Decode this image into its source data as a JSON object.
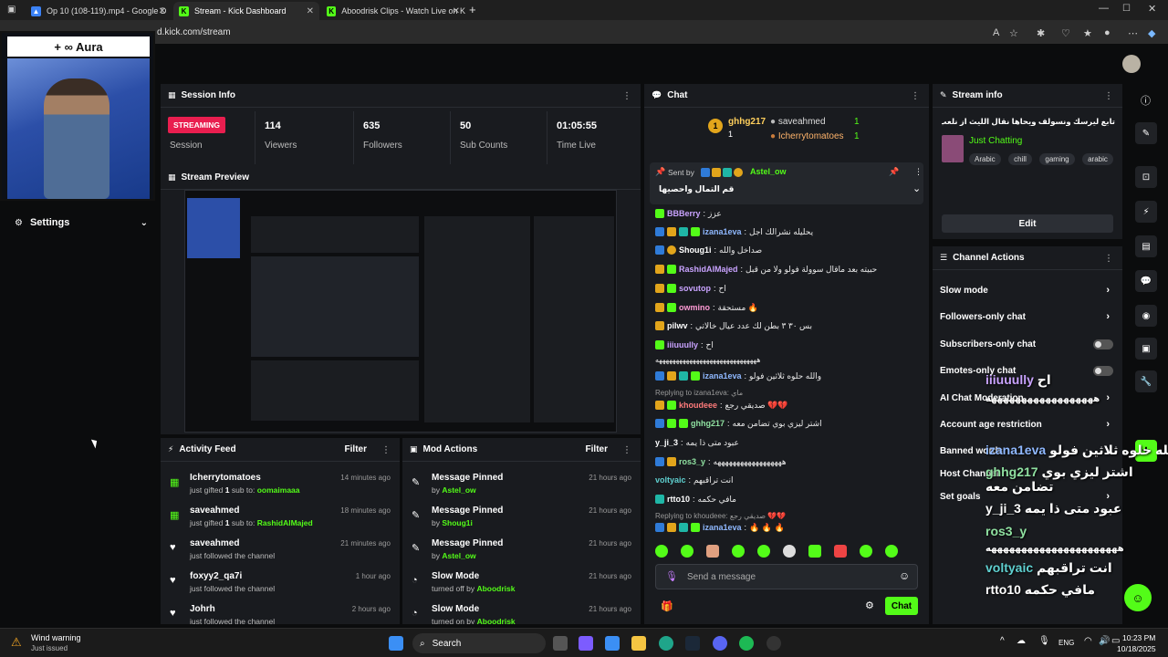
{
  "browser": {
    "tabs": [
      {
        "label": "Op 10 (108-119).mp4 - Google D"
      },
      {
        "label": "Stream - Kick Dashboard"
      },
      {
        "label": "Aboodrisk Clips - Watch Live on K"
      }
    ],
    "url": "d.kick.com/stream"
  },
  "webcam": {
    "label": "+ ∞ Aura"
  },
  "sidebar": {
    "settings_label": "Settings"
  },
  "session": {
    "title": "Session Info",
    "status": "STREAMING",
    "status_label": "Session",
    "stats": [
      {
        "value": "114",
        "label": "Viewers"
      },
      {
        "value": "635",
        "label": "Followers"
      },
      {
        "value": "50",
        "label": "Sub Counts"
      },
      {
        "value": "01:05:55",
        "label": "Time Live"
      }
    ]
  },
  "preview": {
    "title": "Stream Preview"
  },
  "activity": {
    "title": "Activity Feed",
    "filter": "Filter",
    "items": [
      {
        "name": "Icherrytomatoes",
        "pre": "just gifted ",
        "count": "1",
        "mid": " sub to: ",
        "target": "oomaimaaa",
        "time": "14 minutes ago"
      },
      {
        "name": "saveahmed",
        "pre": "just gifted ",
        "count": "1",
        "mid": " sub to: ",
        "target": "RashidAlMajed",
        "time": "18 minutes ago"
      },
      {
        "name": "saveahmed",
        "pre": "just followed the channel",
        "count": "",
        "mid": "",
        "target": "",
        "time": "21 minutes ago"
      },
      {
        "name": "foxyy2_qa7i",
        "pre": "just followed the channel",
        "count": "",
        "mid": "",
        "target": "",
        "time": "1 hour ago"
      },
      {
        "name": "Johrh",
        "pre": "just followed the channel",
        "count": "",
        "mid": "",
        "target": "",
        "time": "2 hours ago"
      }
    ]
  },
  "mod": {
    "title": "Mod Actions",
    "filter": "Filter",
    "items": [
      {
        "action": "Message Pinned",
        "by": "by ",
        "who": "Astel_ow",
        "time": "21 hours ago"
      },
      {
        "action": "Message Pinned",
        "by": "by ",
        "who": "Shoug1i",
        "time": "21 hours ago"
      },
      {
        "action": "Message Pinned",
        "by": "by ",
        "who": "Astel_ow",
        "time": "21 hours ago"
      },
      {
        "action": "Slow Mode",
        "by": "turned off by ",
        "who": "Aboodrisk",
        "time": "21 hours ago"
      },
      {
        "action": "Slow Mode",
        "by": "turned on by ",
        "who": "Aboodrisk",
        "time": "21 hours ago"
      }
    ]
  },
  "chat": {
    "title": "Chat",
    "top_gifters": [
      {
        "name": "ghhg217",
        "count": "1"
      },
      {
        "name": "saveahmed",
        "count": "1"
      },
      {
        "name": "Icherrytomatoes",
        "count": "1"
      }
    ],
    "pinned": {
      "sent_by": "Sent by",
      "user": "Astel_ow",
      "text": "قم التمال واحصيها"
    },
    "messages": [
      {
        "user": "BBBerry",
        "color": "#c9a3ff",
        "text": "عزز"
      },
      {
        "user": "izana1eva",
        "color": "#8fb8ff",
        "text": "يحليله نشرالك اجل"
      },
      {
        "user": "Shoug1i",
        "color": "#ffffff",
        "text": "صداخل والله"
      },
      {
        "user": "RashidAlMajed",
        "color": "#c9a3ff",
        "text": "حبيته بعد ماقال سوولة فولو ولا من قبل"
      },
      {
        "user": "sovutop",
        "color": "#c9a3ff",
        "text": "اح"
      },
      {
        "user": "owmino",
        "color": "#ff9ad5",
        "text": "مستحقة 🔥"
      },
      {
        "user": "pilwv",
        "color": "#ffffff",
        "text": "بس ٣٠ ٣ بطن لك عدد عيال خالاتي"
      },
      {
        "user": "iiiuuully",
        "color": "#c9a3ff",
        "text": "اح"
      },
      {
        "user": "",
        "color": "#ffffff",
        "text": "ههههههههههههههههههههههههههههههه"
      },
      {
        "user": "izana1eva",
        "color": "#8fb8ff",
        "text": "والله حلوه ثلاثين فولو"
      },
      {
        "user": "khoudeee",
        "color": "#ff7b7b",
        "text": "صديقي رجع 💔💔"
      },
      {
        "user": "ghhg217",
        "color": "#8fe0a0",
        "text": "اشتر ليزي بوي تضامن معه"
      },
      {
        "user": "y_ji_3",
        "color": "#ffffff",
        "text": "عبود متى ذا يمه"
      },
      {
        "user": "ros3_y",
        "color": "#8fe0a0",
        "text": "ههههههههههههههههههه"
      },
      {
        "user": "voltyaic",
        "color": "#5fd0d0",
        "text": "انت تراقبهم"
      },
      {
        "user": "rtto10",
        "color": "#ffffff",
        "text": "مافي حكمه"
      },
      {
        "user": "izana1eva",
        "color": "#8fb8ff",
        "text": "🔥 🔥 🔥"
      }
    ],
    "reply_1": "Replying to izana1eva: ماي",
    "reply_2": "Replying to khoudeee: صديقي رجع 💔💔",
    "input_placeholder": "Send a message",
    "send": "Chat"
  },
  "stream_info": {
    "title": "Stream info",
    "stream_title": "تابع ليرسك ونسولف ويحاها نقال الليث از نلعب ميتل ليست",
    "category": "Just Chatting",
    "tags": [
      "Arabic",
      "chill",
      "gaming",
      "arabic"
    ],
    "edit": "Edit"
  },
  "channel_actions": {
    "title": "Channel Actions",
    "items": [
      "Slow mode",
      "Followers-only chat",
      "Subscribers-only chat",
      "Emotes-only chat",
      "AI Chat Moderation",
      "Account age restriction",
      "Banned words",
      "Host Channel",
      "Set goals"
    ]
  },
  "overlay": {
    "lines": [
      {
        "user": "iiiuuully",
        "text": "اح"
      },
      {
        "user": "",
        "text": "ههههههههههههههههههه"
      },
      {
        "user": "izana1eva",
        "text": "والله حلوه ثلاثين فولو"
      },
      {
        "user": "ghhg217",
        "text": "اشتر ليزي بوي تضامن معه"
      },
      {
        "user": "y_ji_3",
        "text": "عبود متى ذا يمه"
      },
      {
        "user": "ros3_y",
        "text": ""
      },
      {
        "user": "",
        "text": "ههههههههههههههههههههههه"
      },
      {
        "user": "voltyaic",
        "text": "انت تراقبهم"
      },
      {
        "user": "rtto10",
        "text": "مافي حكمه"
      }
    ]
  },
  "taskbar": {
    "weather_title": "Wind warning",
    "weather_sub": "Just issued",
    "search": "Search",
    "lang": "ENG",
    "time": "10:23 PM",
    "date": "10/18/2025"
  },
  "colors": {
    "accent": "#53fc18",
    "panel": "#191b1f",
    "streaming": "#e91e4f"
  }
}
